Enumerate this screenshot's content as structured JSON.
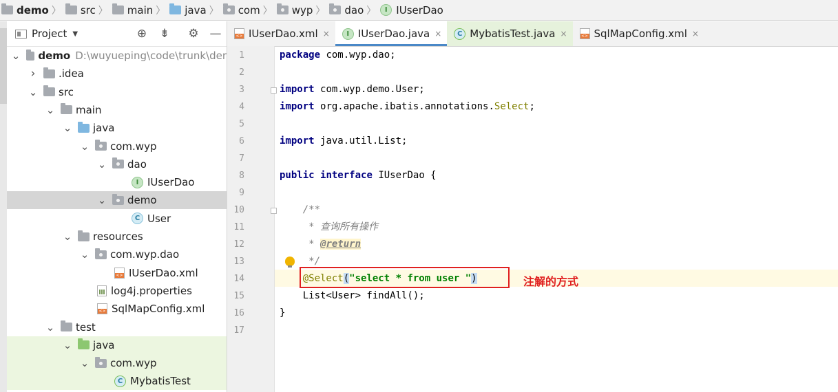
{
  "breadcrumb": {
    "items": [
      {
        "label": "demo",
        "icon": "project-folder-icon",
        "bold": true
      },
      {
        "label": "src",
        "icon": "folder-icon"
      },
      {
        "label": "main",
        "icon": "folder-icon"
      },
      {
        "label": "java",
        "icon": "source-folder-icon"
      },
      {
        "label": "com",
        "icon": "package-icon"
      },
      {
        "label": "wyp",
        "icon": "package-icon"
      },
      {
        "label": "dao",
        "icon": "package-icon"
      },
      {
        "label": "IUserDao",
        "icon": "interface-icon"
      }
    ]
  },
  "panel": {
    "title": "Project",
    "icons": [
      "locate-icon",
      "collapse-icon",
      "gear-icon",
      "minimize-icon"
    ]
  },
  "tree": [
    {
      "label": "demo",
      "path": "D:\\wuyueping\\code\\trunk\\der",
      "bold": true,
      "indent": 0,
      "arrow": "expanded",
      "icon": "module-folder"
    },
    {
      "label": ".idea",
      "indent": 1,
      "arrow": "collapsed",
      "icon": "folder"
    },
    {
      "label": "src",
      "indent": 1,
      "arrow": "expanded",
      "icon": "folder"
    },
    {
      "label": "main",
      "indent": 2,
      "arrow": "expanded",
      "icon": "folder"
    },
    {
      "label": "java",
      "indent": 3,
      "arrow": "expanded",
      "icon": "source-folder"
    },
    {
      "label": "com.wyp",
      "indent": 4,
      "arrow": "expanded",
      "icon": "package"
    },
    {
      "label": "dao",
      "indent": 5,
      "arrow": "expanded",
      "icon": "package"
    },
    {
      "label": "IUserDao",
      "indent": 6,
      "arrow": "none",
      "icon": "interface"
    },
    {
      "label": "demo",
      "indent": 5,
      "arrow": "expanded",
      "icon": "package",
      "selected": true
    },
    {
      "label": "User",
      "indent": 6,
      "arrow": "none",
      "icon": "class"
    },
    {
      "label": "resources",
      "indent": 3,
      "arrow": "expanded",
      "icon": "resources-folder"
    },
    {
      "label": "com.wyp.dao",
      "indent": 4,
      "arrow": "expanded",
      "icon": "package"
    },
    {
      "label": "IUserDao.xml",
      "indent": 5,
      "arrow": "none",
      "icon": "xml"
    },
    {
      "label": "log4j.properties",
      "indent": 4,
      "arrow": "none",
      "icon": "properties"
    },
    {
      "label": "SqlMapConfig.xml",
      "indent": 4,
      "arrow": "none",
      "icon": "xml"
    },
    {
      "label": "test",
      "indent": 2,
      "arrow": "expanded",
      "icon": "folder"
    },
    {
      "label": "java",
      "indent": 3,
      "arrow": "expanded",
      "icon": "test-folder",
      "test": true
    },
    {
      "label": "com.wyp",
      "indent": 4,
      "arrow": "expanded",
      "icon": "package",
      "test": true
    },
    {
      "label": "MybatisTest",
      "indent": 5,
      "arrow": "none",
      "icon": "test-class",
      "test": true
    }
  ],
  "tabs": [
    {
      "label": "IUserDao.xml",
      "icon": "xml",
      "active": false
    },
    {
      "label": "IUserDao.java",
      "icon": "interface",
      "active": true
    },
    {
      "label": "MybatisTest.java",
      "icon": "test-class",
      "active": false,
      "green": true
    },
    {
      "label": "SqlMapConfig.xml",
      "icon": "xml",
      "active": false
    }
  ],
  "close_glyph": "×",
  "code_lines": [
    {
      "n": "1",
      "parts": [
        [
          "kw",
          "package"
        ],
        [
          "",
          "com.wyp.dao;"
        ]
      ]
    },
    {
      "n": "2",
      "parts": []
    },
    {
      "n": "3",
      "parts": [
        [
          "kw",
          "import"
        ],
        [
          "",
          "com.wyp.demo.User;"
        ]
      ]
    },
    {
      "n": "4",
      "parts": [
        [
          "kw",
          "import"
        ],
        [
          "",
          "org.apache.ibatis.annotations."
        ],
        [
          "ann",
          "Select"
        ],
        [
          "",
          ";"
        ]
      ]
    },
    {
      "n": "5",
      "parts": []
    },
    {
      "n": "6",
      "parts": [
        [
          "kw",
          "import"
        ],
        [
          "",
          "java.util.List;"
        ]
      ]
    },
    {
      "n": "7",
      "parts": []
    },
    {
      "n": "8",
      "parts": [
        [
          "kw",
          "public"
        ],
        [
          "kw",
          "interface"
        ],
        [
          "",
          "IUserDao {"
        ]
      ]
    },
    {
      "n": "9",
      "parts": []
    },
    {
      "n": "10",
      "parts": [
        [
          "cmt",
          "    /**"
        ]
      ]
    },
    {
      "n": "11",
      "parts": [
        [
          "cmt",
          "     * 查询所有操作"
        ]
      ]
    },
    {
      "n": "12",
      "parts": [
        [
          "cmt",
          "     * "
        ],
        [
          "tag",
          "@return"
        ]
      ]
    },
    {
      "n": "13",
      "parts": [
        [
          "cmt",
          "     */"
        ]
      ]
    },
    {
      "n": "14",
      "parts": [
        [
          "ann",
          "    @Select"
        ],
        [
          "brace",
          "("
        ],
        [
          "str",
          "\"select * from user \""
        ],
        [
          "brace",
          ")"
        ]
      ]
    },
    {
      "n": "15",
      "parts": [
        [
          "",
          "    List<User> findAll();"
        ]
      ]
    },
    {
      "n": "16",
      "parts": [
        [
          "",
          "}"
        ]
      ]
    },
    {
      "n": "17",
      "parts": []
    }
  ],
  "annotation_note": "注解的方式",
  "colors": {
    "highlight_box": "#e02020",
    "keyword": "#000080",
    "annotation": "#808000",
    "string": "#008000"
  }
}
